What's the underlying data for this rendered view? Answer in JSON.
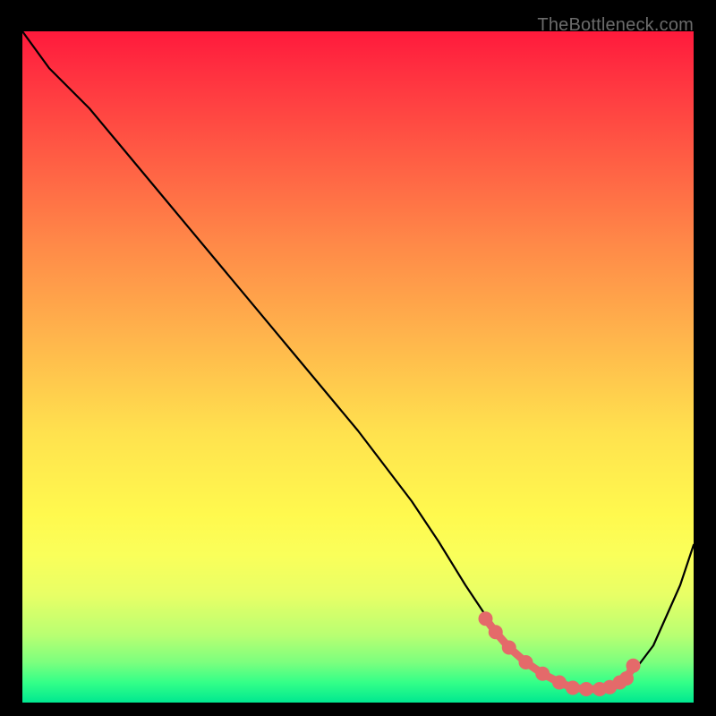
{
  "watermark": "TheBottleneck.com",
  "chart_data": {
    "type": "line",
    "title": "",
    "xlabel": "",
    "ylabel": "",
    "xlim": [
      0,
      100
    ],
    "ylim": [
      0,
      100
    ],
    "grid": false,
    "legend": false,
    "background_gradient": {
      "top": "#ff1a3c",
      "mid": "#fff94e",
      "bottom": "#00e890"
    },
    "curve": {
      "name": "bottleneck-curve",
      "color": "#000000",
      "x": [
        0,
        4,
        10,
        20,
        30,
        40,
        50,
        58,
        62,
        66,
        70,
        74,
        78,
        82,
        86,
        90,
        94,
        98,
        100
      ],
      "y": [
        100,
        94.5,
        88.5,
        76.5,
        64.5,
        52.5,
        40.5,
        30,
        24,
        17.5,
        11.5,
        7,
        4,
        2.2,
        2.0,
        3.2,
        8.5,
        17.5,
        23.5
      ]
    },
    "markers": {
      "name": "bottleneck-valley-markers",
      "color": "#e46a6a",
      "radius_px": 8,
      "x": [
        69,
        70.5,
        72.5,
        75,
        77.5,
        80,
        82,
        84,
        86,
        87.5,
        89,
        90,
        91
      ],
      "y": [
        12.5,
        10.5,
        8.2,
        6.0,
        4.3,
        3.0,
        2.2,
        2.0,
        2.0,
        2.3,
        3.0,
        3.6,
        5.5
      ]
    }
  }
}
